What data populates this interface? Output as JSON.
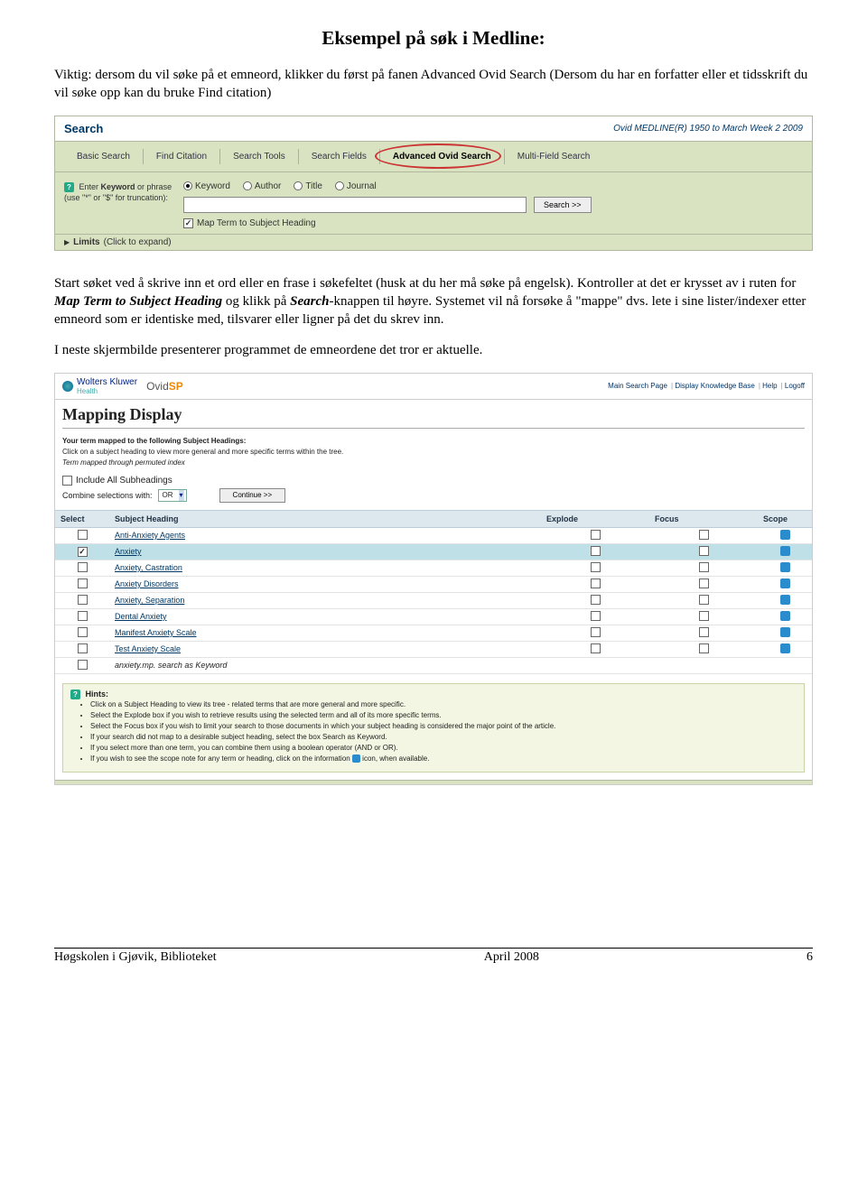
{
  "doc": {
    "title": "Eksempel på søk i Medline:",
    "intro": "Viktig: dersom du vil søke på et emneord, klikker du først på fanen Advanced Ovid Search (Dersom du har en forfatter eller et tidsskrift du vil søke opp kan du bruke Find citation)",
    "para2_a": "Start søket ved å skrive inn et ord eller en frase i søkefeltet (husk at du her må søke på engelsk). Kontroller at det er krysset av i ruten for ",
    "para2_map": "Map Term to Subject Heading",
    "para2_b": " og klikk på ",
    "para2_search": "Search",
    "para2_c": "-knappen til høyre. Systemet vil nå forsøke å \"mappe\" dvs. lete i sine lister/indexer etter emneord som er identiske med, tilsvarer eller ligner på det du skrev inn.",
    "para3": "I neste skjermbilde presenterer programmet de emneordene det tror er aktuelle."
  },
  "searchPanel": {
    "headerLeft": "Search",
    "headerRight": "Ovid MEDLINE(R) 1950 to March Week 2 2009",
    "tabs": [
      "Basic Search",
      "Find Citation",
      "Search Tools",
      "Search Fields",
      "Advanced Ovid Search",
      "Multi-Field Search"
    ],
    "enterKeyword_a": "Enter ",
    "enterKeyword_bold": "Keyword",
    "enterKeyword_b": " or phrase (use \"*\" or \"$\" for truncation):",
    "radios": [
      "Keyword",
      "Author",
      "Title",
      "Journal"
    ],
    "searchBtn": "Search >>",
    "mapLabel": "Map Term to Subject Heading",
    "limits": "Limits",
    "limitsNote": "(Click to expand)"
  },
  "mapping": {
    "wkName": "Wolters Kluwer",
    "wkSub": "Health",
    "ovid": "Ovid",
    "ovidSp": "SP",
    "topLinks": [
      "Main Search Page",
      "Display Knowledge Base",
      "Help",
      "Logoff"
    ],
    "title": "Mapping Display",
    "meta1": "Your term mapped to the following Subject Headings:",
    "meta2": "Click on a subject heading to view more general and more specific terms within the tree.",
    "meta3": "Term mapped through permuted index",
    "includeAll": "Include All Subheadings",
    "combineLabel": "Combine selections with:",
    "combineValue": "OR",
    "continueBtn": "Continue >>",
    "cols": {
      "select": "Select",
      "subject": "Subject Heading",
      "explode": "Explode",
      "focus": "Focus",
      "scope": "Scope"
    },
    "rows": [
      {
        "subject": "Anti-Anxiety Agents",
        "checked": false,
        "link": true,
        "hl": false,
        "keyword": false
      },
      {
        "subject": "Anxiety",
        "checked": true,
        "link": true,
        "hl": true,
        "keyword": false
      },
      {
        "subject": "Anxiety, Castration",
        "checked": false,
        "link": true,
        "hl": false,
        "keyword": false
      },
      {
        "subject": "Anxiety Disorders",
        "checked": false,
        "link": true,
        "hl": false,
        "keyword": false
      },
      {
        "subject": "Anxiety, Separation",
        "checked": false,
        "link": true,
        "hl": false,
        "keyword": false
      },
      {
        "subject": "Dental Anxiety",
        "checked": false,
        "link": true,
        "hl": false,
        "keyword": false
      },
      {
        "subject": "Manifest Anxiety Scale",
        "checked": false,
        "link": true,
        "hl": false,
        "keyword": false
      },
      {
        "subject": "Test Anxiety Scale",
        "checked": false,
        "link": true,
        "hl": false,
        "keyword": false
      },
      {
        "subject": "anxiety.mp. search as Keyword",
        "checked": false,
        "link": false,
        "hl": false,
        "keyword": true
      }
    ],
    "hintsTitle": "Hints:",
    "hints": [
      "Click on a Subject Heading to view its tree - related terms that are more general and more specific.",
      "Select the Explode box if you wish to retrieve results using the selected term and all of its more specific terms.",
      "Select the Focus box if you wish to limit your search to those documents in which your subject heading is considered the major point of the article.",
      "If your search did not map to a desirable subject heading, select the box Search as Keyword.",
      "If you select more than one term, you can combine them using a boolean operator (AND or OR).",
      "If you wish to see the scope note for any term or heading, click on the information __ICON__ icon, when available."
    ]
  },
  "footer": {
    "left": "Høgskolen i Gjøvik, Biblioteket",
    "center": "April 2008",
    "right": "6"
  }
}
